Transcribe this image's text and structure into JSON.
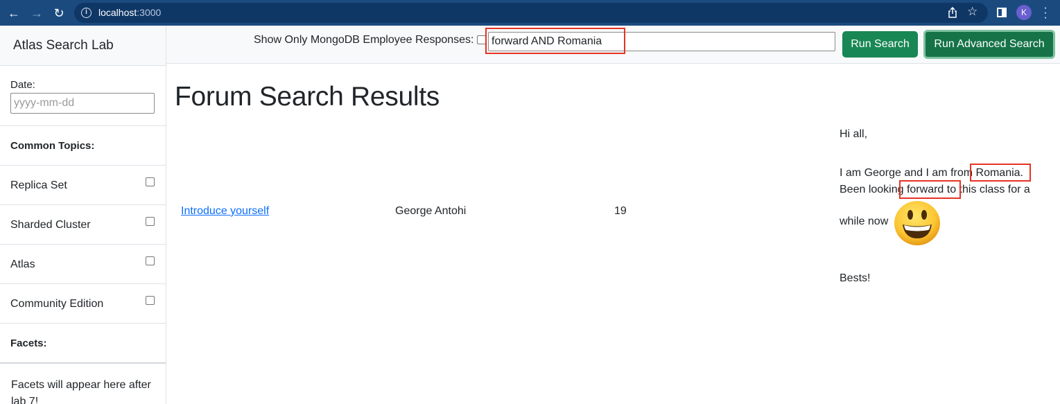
{
  "browser": {
    "url_host": "localhost",
    "url_port": ":3000",
    "profile_initial": "K",
    "icons": [
      "back-arrow-icon",
      "forward-arrow-icon",
      "reload-icon",
      "info-icon",
      "share-icon",
      "star-icon",
      "side-panel-icon",
      "kebab-menu-icon"
    ]
  },
  "sidebar": {
    "brand": "Atlas Search Lab",
    "date_label": "Date:",
    "date_placeholder": "yyyy-mm-dd",
    "common_topics_heading": "Common Topics:",
    "topics": [
      {
        "label": "Replica Set",
        "checked": false
      },
      {
        "label": "Sharded Cluster",
        "checked": false
      },
      {
        "label": "Atlas",
        "checked": false
      },
      {
        "label": "Community Edition",
        "checked": false
      }
    ],
    "facets_heading": "Facets:",
    "facets_text": "Facets will appear here after lab 7!"
  },
  "topbar": {
    "employee_label": "Show Only MongoDB Employee Responses:",
    "employee_checked": false,
    "search_value": "forward AND Romania",
    "run_search_label": "Run Search",
    "run_advanced_label": "Run Advanced Search"
  },
  "main": {
    "title": "Forum Search Results",
    "results": [
      {
        "title": "Introduce yourself",
        "author": "George Antohi",
        "score": "19",
        "snippet": {
          "line1": "Hi all,",
          "line2": "I am George and I am from Romania.",
          "line3": "Been looking forward to this class for a",
          "line4": "while now",
          "line5": "Bests!",
          "emoji": "smiley-emoji"
        }
      }
    ]
  },
  "colors": {
    "chrome": "#1b4a7f",
    "primary_green": "#198754",
    "link_blue": "#0d6efd",
    "highlight_red": "#e53323"
  }
}
